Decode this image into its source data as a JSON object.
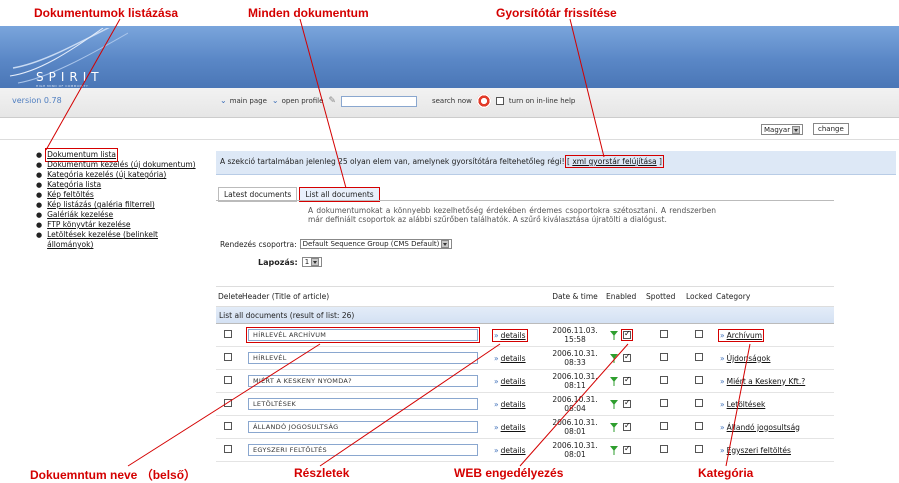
{
  "callouts": {
    "doc_list": "Dokumentumok listázása",
    "all_docs": "Minden dokumentum",
    "cache_refresh": "Gyorsítótár frissítése",
    "doc_name": "Dokuemntum neve （belső）",
    "details": "Részletek",
    "web_enable": "WEB engedélyezés",
    "category": "Kategória"
  },
  "logo": {
    "title": "SPIRIT",
    "tagline": "HIGH MIND OF COMMUNITY"
  },
  "version": "version 0.78",
  "toolbar": {
    "main_page": "main page",
    "open_profile": "open profile",
    "search_value": "",
    "search_now": "search now",
    "inline_help": "turn on in-line help"
  },
  "lang": {
    "selected": "Magyar",
    "change": "change"
  },
  "sidebar": {
    "items": [
      "Dokumentum lista",
      "Dokumentum kezelés (új dokumentum)",
      "Kategória kezelés (új kategória)",
      "Kategória lista",
      "Kép feltöltés",
      "Kép listázás (galéria filterrel)",
      "Galériák kezelése",
      "FTP könyvtár kezelése",
      "Letöltések kezelése (belinkelt",
      "állományok)"
    ]
  },
  "notice": {
    "text": "A szekció tartalmában jelenleg 25 olyan elem van, amelynek gyorsítótára feltehetőleg régi!",
    "link": "xml gyorstár felújítása"
  },
  "tabs": [
    "Latest documents",
    "List all documents"
  ],
  "description": "A dokumentumokat a könnyebb kezelhetőség érdekében érdemes csoportokra szétosztani. A rendszerben már definiált csoportok az alábbi szűrőben találhatók. A szűrő kiválasztása újratölti a dialógust.",
  "group": {
    "label": "Rendezés csoportra:",
    "selected": "Default Sequence Group (CMS Default)"
  },
  "paging": {
    "label": "Lapozás:",
    "selected": "1"
  },
  "table": {
    "headers": {
      "delete": "Delete",
      "header": "Header (Title of article)",
      "date": "Date & time",
      "enabled": "Enabled",
      "spotted": "Spotted",
      "locked": "Locked",
      "category": "Category"
    },
    "subheader": "List all documents (result of list: 26)",
    "details_label": "details",
    "rows": [
      {
        "title": "HÍRLEVÉL ARCHÍVUM",
        "date": "2006.11.03.",
        "time": "15:58",
        "category": "Archívum"
      },
      {
        "title": "HÍRLEVÉL",
        "date": "2006.10.31.",
        "time": "08:33",
        "category": "Újdonságok"
      },
      {
        "title": "MIÉRT A KESKENY NYOMDA?",
        "date": "2006.10.31.",
        "time": "08:11",
        "category": "Miért a Keskeny Kft.?"
      },
      {
        "title": "LETÖLTÉSEK",
        "date": "2006.10.31.",
        "time": "08:04",
        "category": "Letöltések"
      },
      {
        "title": "ÁLLANDÓ JOGOSULTSÁG",
        "date": "2006.10.31.",
        "time": "08:01",
        "category": "Állandó jogosultság"
      },
      {
        "title": "EGYSZERI FELTÖLTÉS",
        "date": "2006.10.31.",
        "time": "08:01",
        "category": "Egyszeri feltöltés"
      }
    ]
  },
  "colors": {
    "callout": "#d40000",
    "header_blue": "#5a87c6",
    "link_blue": "#3d6fb8"
  }
}
